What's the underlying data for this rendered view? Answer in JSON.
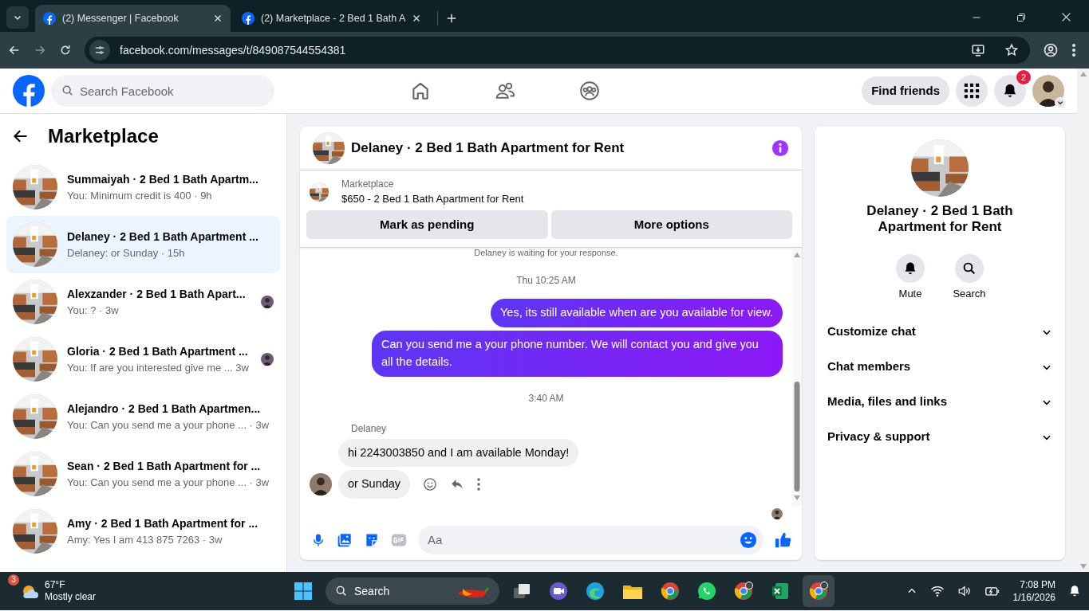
{
  "browser": {
    "tabs": [
      {
        "title": "(2) Messenger | Facebook",
        "selected": true
      },
      {
        "title": "(2) Marketplace - 2 Bed 1 Bath A",
        "selected": false
      }
    ],
    "url": "facebook.com/messages/t/849087544554381"
  },
  "header": {
    "search": {
      "placeholder": "Search Facebook"
    },
    "find_friends": "Find friends",
    "notification_count": "2"
  },
  "sidebar": {
    "title": "Marketplace",
    "conversations": [
      {
        "title": "Summaiyah · 2 Bed 1 Bath Apartm...",
        "preview": "You: Minimum credit is 400 · 9h",
        "selected": false,
        "seen": false
      },
      {
        "title": "Delaney · 2 Bed 1 Bath Apartment ...",
        "preview": "Delaney: or Sunday · 15h",
        "selected": true,
        "seen": false
      },
      {
        "title": "Alexzander · 2 Bed 1 Bath Apart...",
        "preview": "You: ? · 3w",
        "selected": false,
        "seen": true
      },
      {
        "title": "Gloria · 2 Bed 1 Bath Apartment ...",
        "preview": "You: If are you interested give me ...  3w",
        "selected": false,
        "seen": true
      },
      {
        "title": "Alejandro · 2 Bed 1 Bath Apartmen...",
        "preview": "You: Can you send me a your phone ... · 3w",
        "selected": false,
        "seen": false
      },
      {
        "title": "Sean · 2 Bed 1 Bath Apartment for ...",
        "preview": "You: Can you send me a your phone ... · 3w",
        "selected": false,
        "seen": false
      },
      {
        "title": "Amy · 2 Bed 1 Bath Apartment for ...",
        "preview": "Amy: Yes I am 413 875 7263 · 3w",
        "selected": false,
        "seen": false
      }
    ]
  },
  "chat": {
    "title": "Delaney · 2 Bed 1 Bath Apartment for Rent",
    "listing": {
      "label": "Marketplace",
      "title": "$650 - 2 Bed 1 Bath Apartment for Rent"
    },
    "actions": [
      "Mark as pending",
      "More options"
    ],
    "messages": [
      {
        "kind": "notice",
        "text": "Delaney is waiting for your response."
      },
      {
        "kind": "time",
        "text": "Thu 10:25 AM"
      },
      {
        "kind": "sent",
        "text": "Yes, its still available when are you available for view."
      },
      {
        "kind": "sent",
        "text": "Can you send me a your phone number. We will contact you and give you all the details."
      },
      {
        "kind": "time",
        "text": "3:40 AM"
      },
      {
        "kind": "sender",
        "text": "Delaney"
      },
      {
        "kind": "received",
        "text": "hi 2243003850 and I am available Monday!",
        "avatar": false
      },
      {
        "kind": "received",
        "text": "or Sunday",
        "avatar": true
      }
    ],
    "composer": {
      "placeholder": "Aa"
    }
  },
  "info": {
    "title": "Delaney · 2 Bed 1 Bath Apartment for Rent",
    "actions": [
      {
        "label": "Mute",
        "kind": "mute"
      },
      {
        "label": "Search",
        "kind": "search"
      }
    ],
    "sections": [
      "Customize chat",
      "Chat members",
      "Media, files and links",
      "Privacy & support"
    ]
  },
  "taskbar": {
    "weather": {
      "badge": "3",
      "temperature": "67°F",
      "condition": "Mostly clear"
    },
    "search": {
      "placeholder": "Search"
    },
    "time": "7:08 PM",
    "date": "1/16/2026"
  }
}
